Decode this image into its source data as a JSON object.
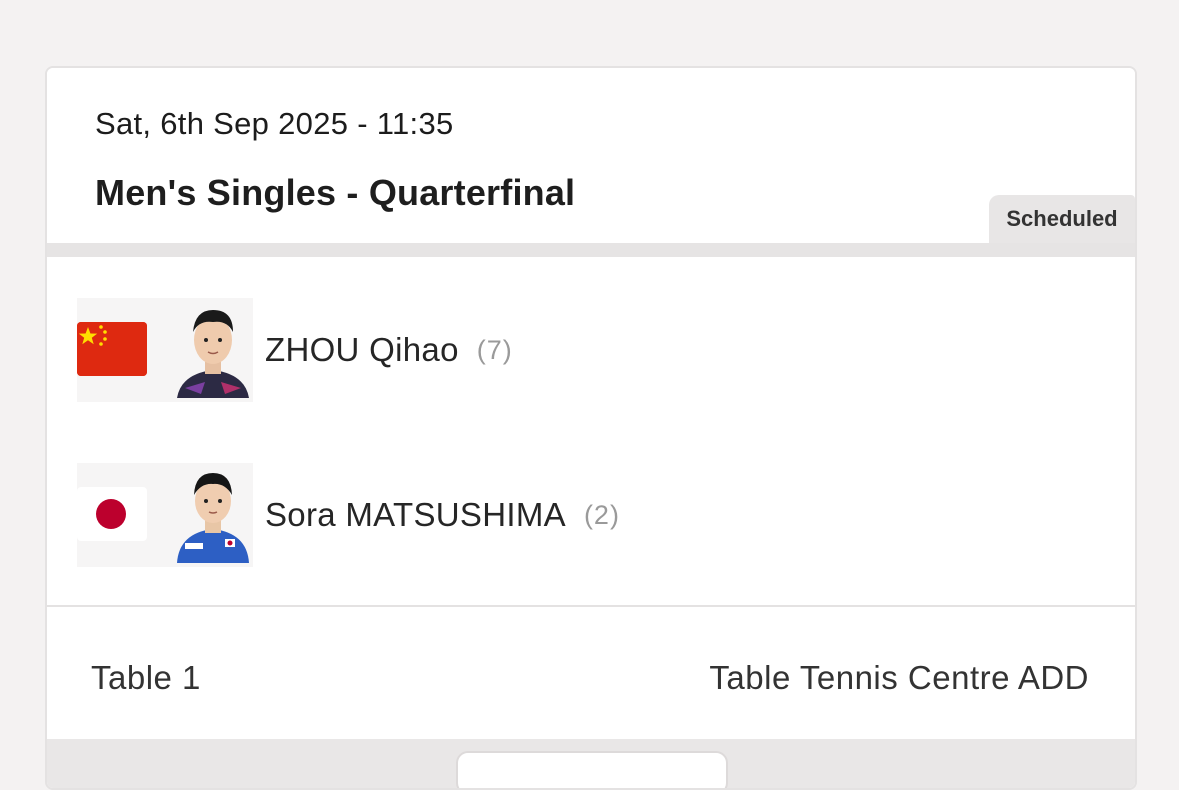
{
  "match": {
    "datetime": "Sat, 6th Sep 2025 - 11:35",
    "event": "Men's Singles - Quarterfinal",
    "status": "Scheduled"
  },
  "players": [
    {
      "name": "ZHOU Qihao",
      "seed": "(7)",
      "flag_icon": "china-flag-icon",
      "flag_color": "#de2910"
    },
    {
      "name": "Sora MATSUSHIMA",
      "seed": "(2)",
      "flag_icon": "japan-flag-icon",
      "flag_color": "#bc002d"
    }
  ],
  "footer": {
    "table": "Table 1",
    "venue": "Table Tennis Centre ADD"
  }
}
